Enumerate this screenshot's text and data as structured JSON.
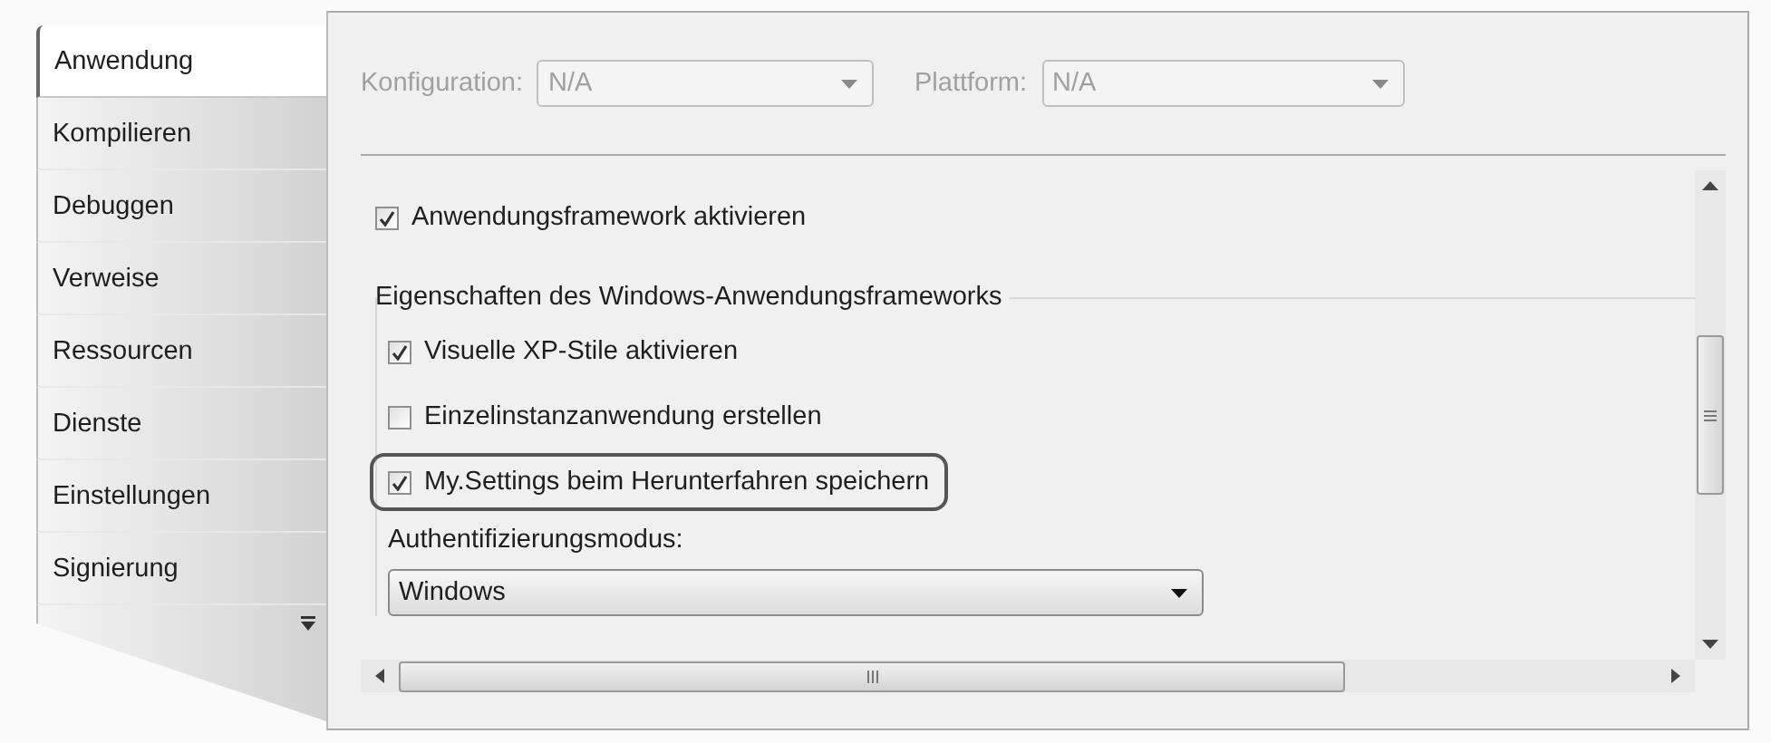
{
  "tabs": [
    {
      "label": "Anwendung",
      "selected": true
    },
    {
      "label": "Kompilieren",
      "selected": false
    },
    {
      "label": "Debuggen",
      "selected": false
    },
    {
      "label": "Verweise",
      "selected": false
    },
    {
      "label": "Ressourcen",
      "selected": false
    },
    {
      "label": "Dienste",
      "selected": false
    },
    {
      "label": "Einstellungen",
      "selected": false
    },
    {
      "label": "Signierung",
      "selected": false
    }
  ],
  "selectors": [
    {
      "label": "Konfiguration:",
      "value": "N/A",
      "disabled": true
    },
    {
      "label": "Plattform:",
      "value": "N/A",
      "disabled": true
    }
  ],
  "framework": {
    "label": "Anwendungsframework aktivieren",
    "checked": true
  },
  "group": {
    "title": "Eigenschaften des Windows-Anwendungsframeworks",
    "options": [
      {
        "label": "Visuelle XP-Stile aktivieren",
        "checked": true,
        "highlighted": false
      },
      {
        "label": "Einzelinstanzanwendung erstellen",
        "checked": false,
        "highlighted": false
      },
      {
        "label": "My.Settings beim Herunterfahren speichern",
        "checked": true,
        "highlighted": true
      }
    ],
    "auth_label": "Authentifizierungsmodus:",
    "auth_value": "Windows"
  }
}
